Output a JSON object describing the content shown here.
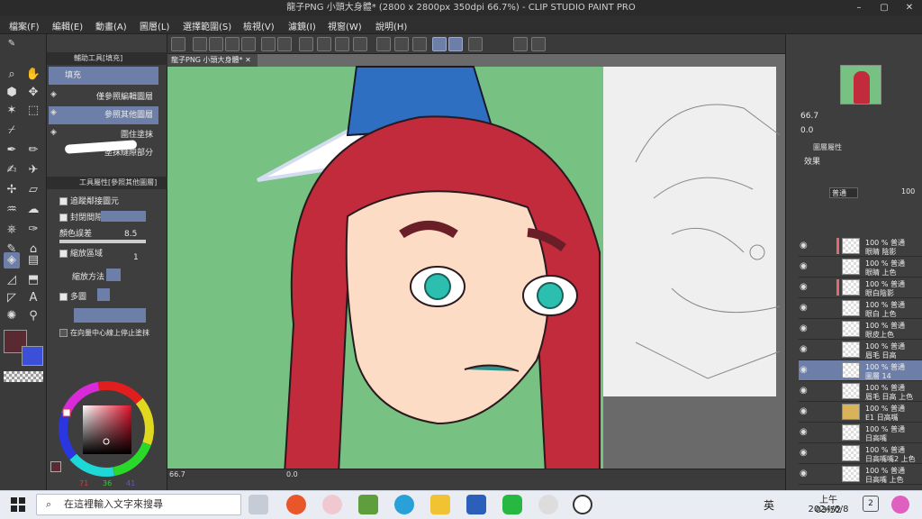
{
  "window": {
    "title": "龍子PNG 小頭大身體* (2800 x 2800px 350dpi 66.7%)  - CLIP STUDIO PAINT PRO",
    "controls": [
      "–",
      "▢",
      "✕"
    ]
  },
  "menu": [
    "檔案(F)",
    "編輯(E)",
    "動畫(A)",
    "圖層(L)",
    "選擇範圍(S)",
    "檢視(V)",
    "濾鏡(I)",
    "視窗(W)",
    "說明(H)"
  ],
  "subtool_panel": {
    "header": "輔助工具[填充]",
    "items": [
      "填充",
      "僅參照編輯圖層",
      "參照其他圖層",
      "圍住塗抹",
      "塗抹縫隙部分"
    ],
    "selected_index": 2
  },
  "tool_property": {
    "header": "工具屬性[參照其他圖層]",
    "rows": {
      "adjacent": "追蹤鄰接圖元",
      "close_gap": "封閉間隙",
      "color_margin_label": "顏色誤差",
      "color_margin_value": "8.5",
      "scale_area": "縮放區域",
      "scale_value": "1",
      "scale_method": "縮放方法",
      "multi_ref": "多圖",
      "stop_center": "在向量中心線上停止塗抹"
    }
  },
  "color": {
    "main": "#5a2a33",
    "sub": "#3b4fd8",
    "r": "71",
    "g": "36",
    "b": "41"
  },
  "canvas": {
    "tab": "龍子PNG 小頭大身體*",
    "bg_color": "#77c283"
  },
  "status": {
    "zoom": "66.7",
    "angle": "0.0"
  },
  "navigator": {
    "zoom": "66.7",
    "angle": "0.0"
  },
  "layer_panel": {
    "tabs": [
      "圖層屬性"
    ],
    "effect_label": "效果",
    "blend_mode": "普通",
    "opacity": "100",
    "layers": [
      {
        "t1": "100 % 普通",
        "t2": "眼睛 陰影",
        "bar": true
      },
      {
        "t1": "100 % 普通",
        "t2": "眼睛 上色",
        "bar": false
      },
      {
        "t1": "100 % 普通",
        "t2": "眼白陰影",
        "bar": true
      },
      {
        "t1": "100 % 普通",
        "t2": "眼白 上色",
        "bar": false
      },
      {
        "t1": "100 % 普通",
        "t2": "眼皮上色",
        "bar": false
      },
      {
        "t1": "100 % 普通",
        "t2": "眉毛 日高",
        "bar": false
      },
      {
        "t1": "100 % 普通",
        "t2": "圖層 14",
        "bar": false,
        "selected": true
      },
      {
        "t1": "100 % 普通",
        "t2": "眉毛 日高 上色",
        "bar": false
      },
      {
        "t1": "100 % 普通",
        "t2": "E1 日高嘴",
        "bar": false,
        "folder": true
      },
      {
        "t1": "100 % 普通",
        "t2": "日高嘴",
        "bar": false
      },
      {
        "t1": "100 % 普通",
        "t2": "日高嘴嘴2 上色",
        "bar": false
      },
      {
        "t1": "100 % 普通",
        "t2": "日高嘴 上色",
        "bar": false
      }
    ]
  },
  "taskbar": {
    "search_placeholder": "在這裡輸入文字來搜尋",
    "ime": "英",
    "time": "上午 03:52",
    "date": "2024/6/8",
    "notif": "2"
  }
}
